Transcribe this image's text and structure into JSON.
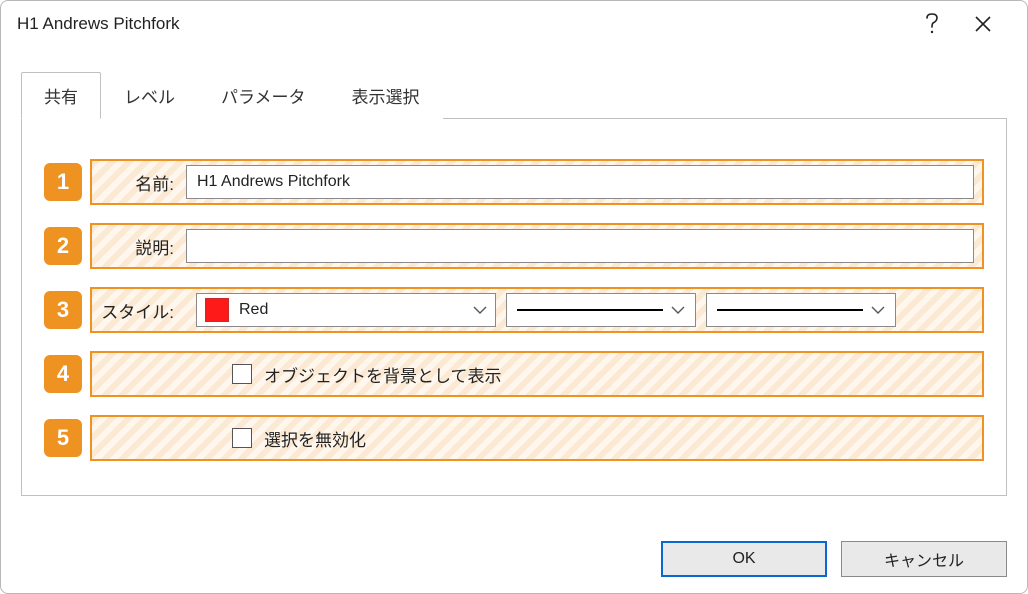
{
  "window": {
    "title": "H1 Andrews Pitchfork"
  },
  "tabs": [
    {
      "label": "共有",
      "active": true
    },
    {
      "label": "レベル",
      "active": false
    },
    {
      "label": "パラメータ",
      "active": false
    },
    {
      "label": "表示選択",
      "active": false
    }
  ],
  "fields": {
    "name": {
      "num": "1",
      "label": "名前:",
      "value": "H1 Andrews Pitchfork"
    },
    "desc": {
      "num": "2",
      "label": "説明:",
      "value": ""
    },
    "style": {
      "num": "3",
      "label": "スタイル:",
      "color_name": "Red",
      "color_hex": "#ff1a1a"
    },
    "drawbg": {
      "num": "4",
      "label": "オブジェクトを背景として表示",
      "checked": false
    },
    "disable": {
      "num": "5",
      "label": "選択を無効化",
      "checked": false
    }
  },
  "buttons": {
    "ok": "OK",
    "cancel": "キャンセル"
  }
}
